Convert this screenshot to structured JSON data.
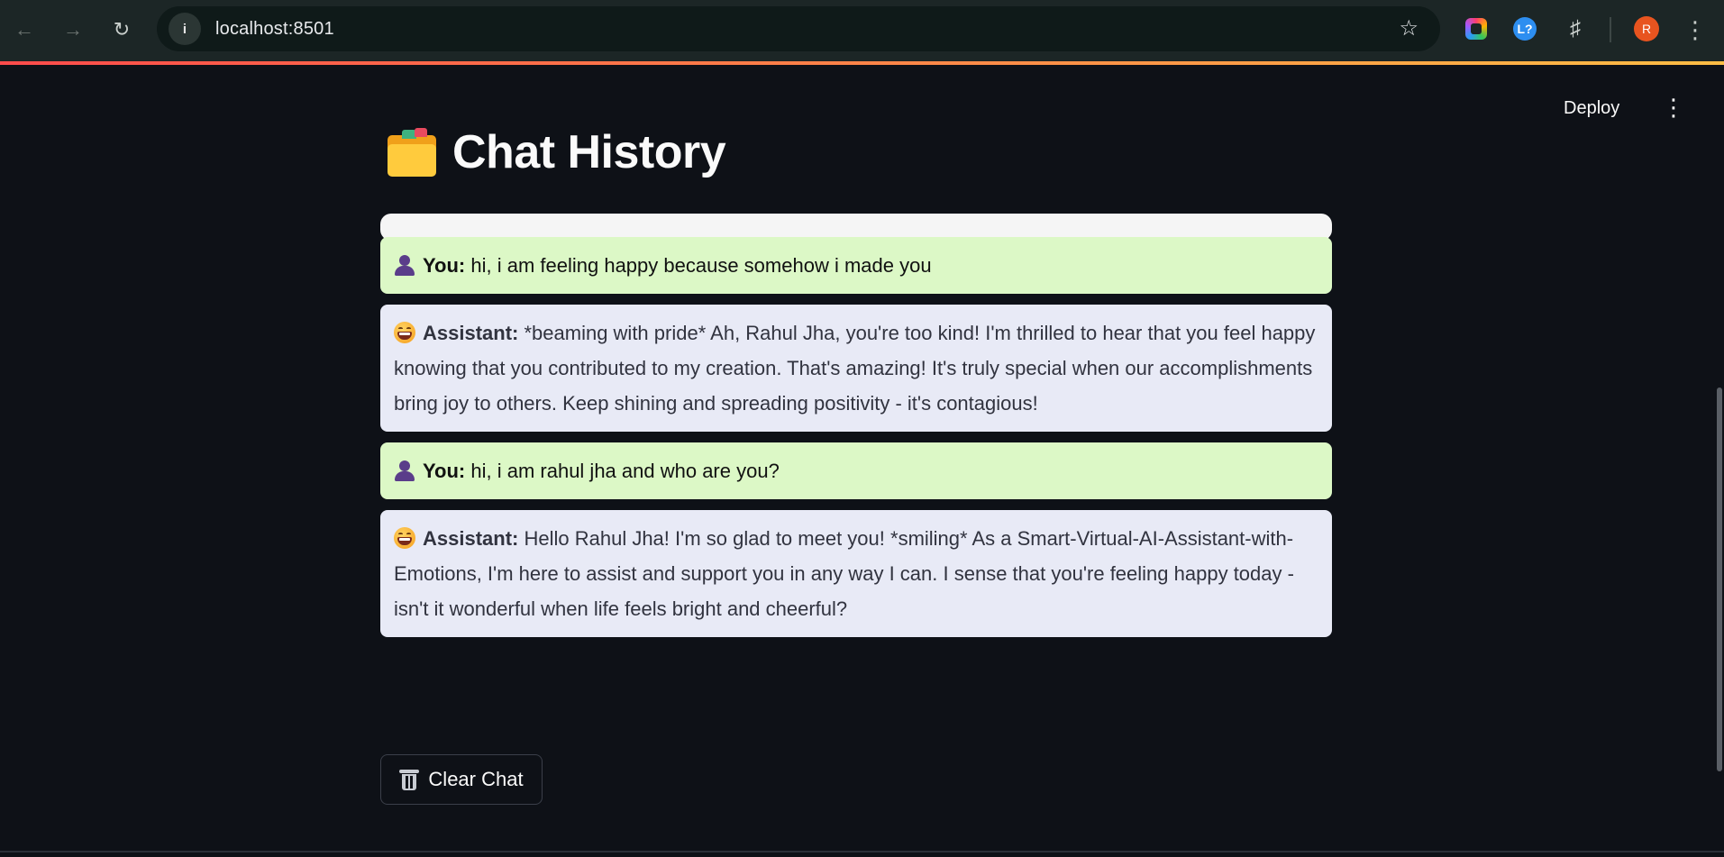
{
  "browser": {
    "url": "localhost:8501",
    "profile_initial": "R",
    "extension_l_label": "L?"
  },
  "app": {
    "deploy_label": "Deploy",
    "title": "Chat History",
    "title_icon": "folder-icon",
    "clear_button_label": "Clear Chat",
    "clear_button_icon": "trash-icon"
  },
  "messages": [
    {
      "role": "user",
      "speaker": "You:",
      "icon": "person-icon",
      "text": "hi, i am feeling happy because somehow i made you"
    },
    {
      "role": "assistant",
      "speaker": "Assistant:",
      "icon": "grinning-face-icon",
      "text": "*beaming with pride* Ah, Rahul Jha, you're too kind! I'm thrilled to hear that you feel happy knowing that you contributed to my creation. That's amazing! It's truly special when our accomplishments bring joy to others. Keep shining and spreading positivity - it's contagious!"
    },
    {
      "role": "user",
      "speaker": "You:",
      "icon": "person-icon",
      "text": "hi, i am rahul jha and who are you?"
    },
    {
      "role": "assistant",
      "speaker": "Assistant:",
      "icon": "grinning-face-icon",
      "text": "Hello Rahul Jha! I'm so glad to meet you! *smiling* As a Smart-Virtual-AI-Assistant-with-Emotions, I'm here to assist and support you in any way I can. I sense that you're feeling happy today - isn't it wonderful when life feels bright and cheerful?"
    }
  ],
  "colors": {
    "background": "#0e1117",
    "user_bubble": "#dcf8c6",
    "assistant_bubble": "#e8eaf6",
    "accent_gradient_start": "#ff4b4b",
    "accent_gradient_end": "#ffbd45"
  }
}
